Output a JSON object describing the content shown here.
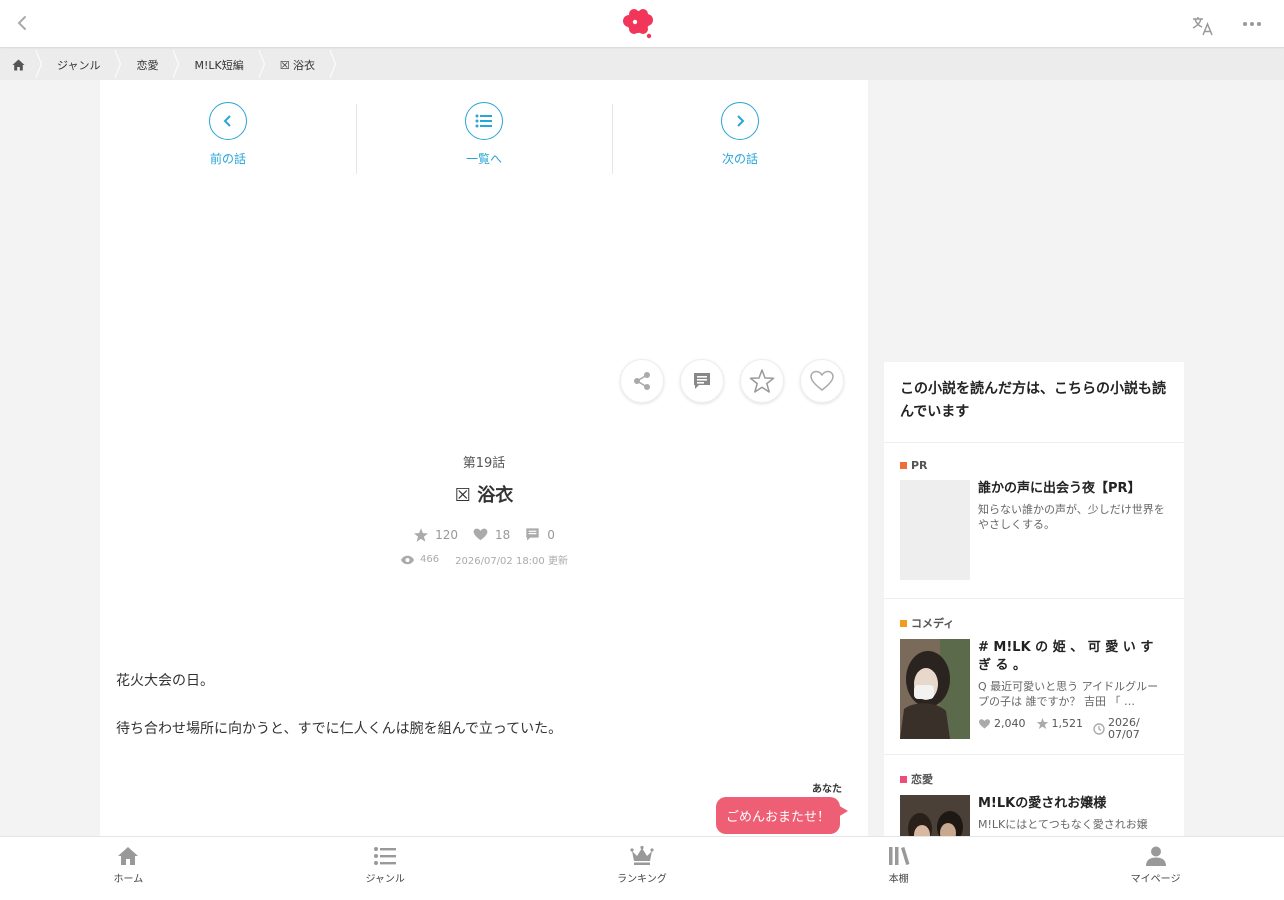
{
  "header": {
    "back_icon": "chevron-left-icon",
    "logo_icon": "brand-logo-icon",
    "translate_icon": "translate-icon",
    "more_icon": "more-horizontal-icon",
    "brand_color": "#f2365a"
  },
  "breadcrumb": {
    "home_icon": "home-icon",
    "items": [
      "ジャンル",
      "恋愛",
      "M!LK短編",
      "☒ 浴衣"
    ]
  },
  "chapter_nav": {
    "prev": "前の話",
    "list": "一覧へ",
    "next": "次の話",
    "accent": "#27a6d8"
  },
  "actions": [
    "share-icon",
    "comment-icon",
    "star-icon",
    "heart-icon"
  ],
  "episode": {
    "number": "第19話",
    "title": "☒ 浴衣",
    "stars": "120",
    "likes": "18",
    "comments": "0",
    "views": "466",
    "updated": "2026/07/02 18:00 更新"
  },
  "body": {
    "line1": "花火大会の日。",
    "line2": "待ち合わせ場所に向かうと、すでに仁人くんは腕を組んで立っていた。",
    "speaker": "あなた",
    "bubble": "ごめんおまたせ！",
    "bubble_color": "#ee5e74"
  },
  "sidebar": {
    "heading": "この小説を読んだ方は、こちらの小説も読んでいます",
    "recs": [
      {
        "tag": "PR",
        "tag_color": "#f26b3a",
        "title": "誰かの声に出会う夜【PR】",
        "desc": "知らない誰かの声が、少しだけ世界をやさしくする。"
      },
      {
        "tag": "コメディ",
        "tag_color": "#f29c1f",
        "title": "# M!LK の 姫 、 可 愛 い す ぎ る 。",
        "desc": "Q 最近可愛いと思う アイドルグループの子は 誰ですか？ 吉田 「 …",
        "likes": "2,040",
        "stars": "1,521",
        "date": "2026/07/07"
      },
      {
        "tag": "恋愛",
        "tag_color": "#ee4d7a",
        "title": "M!LKの愛されお嬢様",
        "desc": "M!LKにはとてつもなく愛されお嬢"
      }
    ]
  },
  "bottom_nav": [
    {
      "label": "ホーム",
      "icon": "home-icon"
    },
    {
      "label": "ジャンル",
      "icon": "list-icon"
    },
    {
      "label": "ランキング",
      "icon": "crown-icon"
    },
    {
      "label": "本棚",
      "icon": "bookshelf-icon"
    },
    {
      "label": "マイページ",
      "icon": "person-icon"
    }
  ]
}
